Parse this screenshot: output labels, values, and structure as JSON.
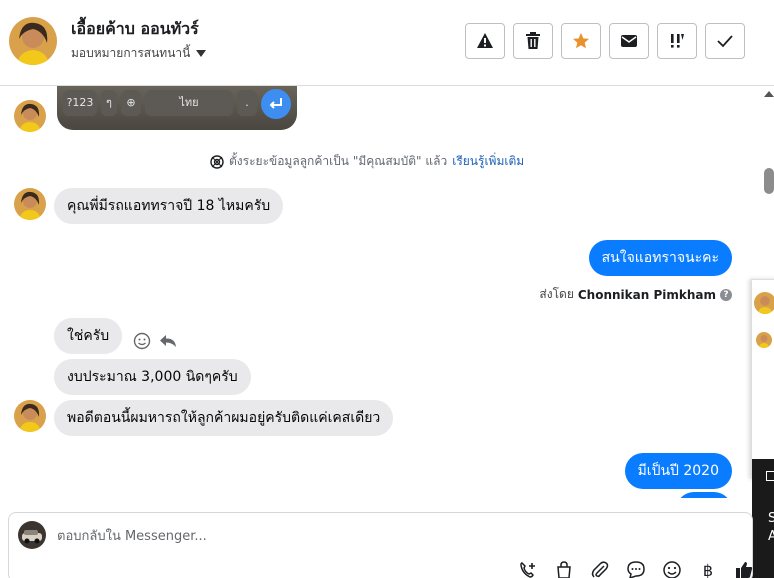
{
  "header": {
    "contact_name": "เอื้อยค้าบ ออนทัวร์",
    "assign_label": "มอบหมายการสนทนานี้",
    "toolbar": {
      "icons": [
        "warning-icon",
        "trash-icon",
        "star-icon",
        "envelope-icon",
        "priority-icon",
        "check-icon"
      ],
      "star_color": "#e8912d"
    }
  },
  "thread": {
    "keyboard_preview": {
      "key_numbers": "?123",
      "key_lang": "ไทย",
      "key_period": "."
    },
    "system_note": {
      "text": "ตั้งระยะข้อมูลลูกค้าเป็น \"มีคุณสมบัติ\" แล้ว",
      "link": "เรียนรู้เพิ่มเติม"
    },
    "messages": [
      {
        "direction": "in",
        "text": "คุณพี่มีรถแอททราจปี 18 ไหมครับ"
      },
      {
        "direction": "out",
        "text": "สนใจแอทราจนะคะ"
      },
      {
        "direction": "in",
        "text": "ใช่ครับ"
      },
      {
        "direction": "in",
        "text": "งบประมาณ 3,000 นิดๆครับ"
      },
      {
        "direction": "in",
        "text": "พอดีตอนนี้ผมหารถให้ลูกค้าผมอยู่ครับติดแค่เคสเดียว"
      },
      {
        "direction": "out",
        "text": "มีเป็นปี 2020"
      }
    ],
    "sent_by": {
      "prefix": "ส่งโดย",
      "name": "Chonnikan Pimkham"
    }
  },
  "side_panel": {
    "dark_text_1": "S",
    "dark_text_2": "A"
  },
  "composer": {
    "placeholder": "ตอบกลับใน Messenger...",
    "tools": [
      "add-contact-icon",
      "shopping-bag-icon",
      "paperclip-icon",
      "saved-reply-icon",
      "emoji-icon",
      "baht-icon",
      "thumbs-up-icon"
    ],
    "baht_symbol": "฿"
  },
  "colors": {
    "outgoing_bubble": "#0a7cff",
    "incoming_bubble": "#e9e9eb",
    "link": "#1a5fb4"
  }
}
